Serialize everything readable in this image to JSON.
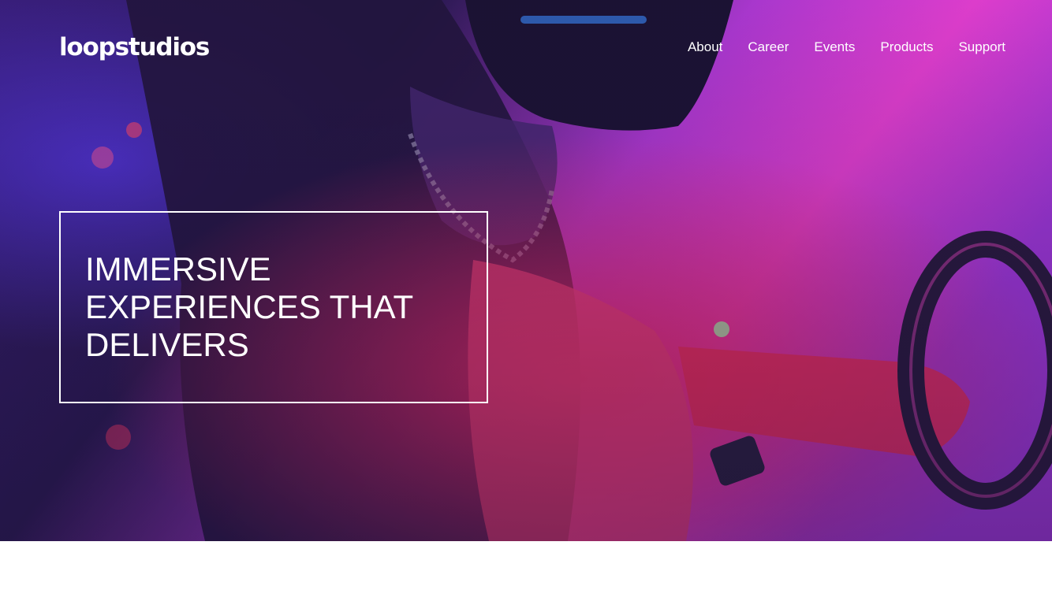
{
  "header": {
    "logo_text": "loopstudios",
    "nav": [
      {
        "label": "About"
      },
      {
        "label": "Career"
      },
      {
        "label": "Events"
      },
      {
        "label": "Products"
      },
      {
        "label": "Support"
      }
    ]
  },
  "hero": {
    "headline": "IMMERSIVE EXPERIENCES THAT DELIVERS",
    "image_subject": "person-with-vr-headset-and-steering-wheel",
    "colors": {
      "magenta": "#ff3ce0",
      "violet": "#7a3cf5",
      "deep": "#1e1446",
      "red": "#ff2f5a"
    }
  }
}
